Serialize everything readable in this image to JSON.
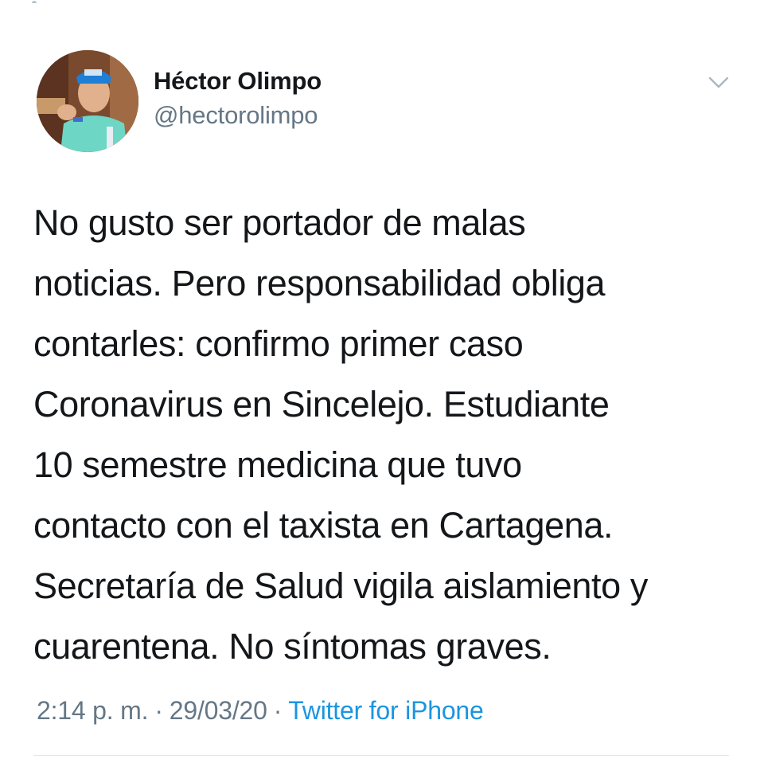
{
  "tweet": {
    "author": {
      "display_name": "Héctor Olimpo",
      "handle": "@hectorolimpo"
    },
    "text": "No gusto ser portador de malas\nnoticias. Pero responsabilidad obliga\ncontarles: confirmo primer caso\nCoronavirus en Sincelejo. Estudiante\n10 semestre medicina que tuvo\ncontacto con el taxista en Cartagena.\nSecretaría de Salud vigila aislamiento y\ncuarentena. No síntomas graves.",
    "time": "2:14 p. m.",
    "date": "29/03/20",
    "source": "Twitter for iPhone",
    "separator": "·"
  },
  "icons": {
    "menu": "chevron-down-icon",
    "avatar": "avatar"
  },
  "colors": {
    "text_primary": "#14171a",
    "text_secondary": "#657786",
    "link": "#1b95e0",
    "divider": "#e1e8ed"
  }
}
